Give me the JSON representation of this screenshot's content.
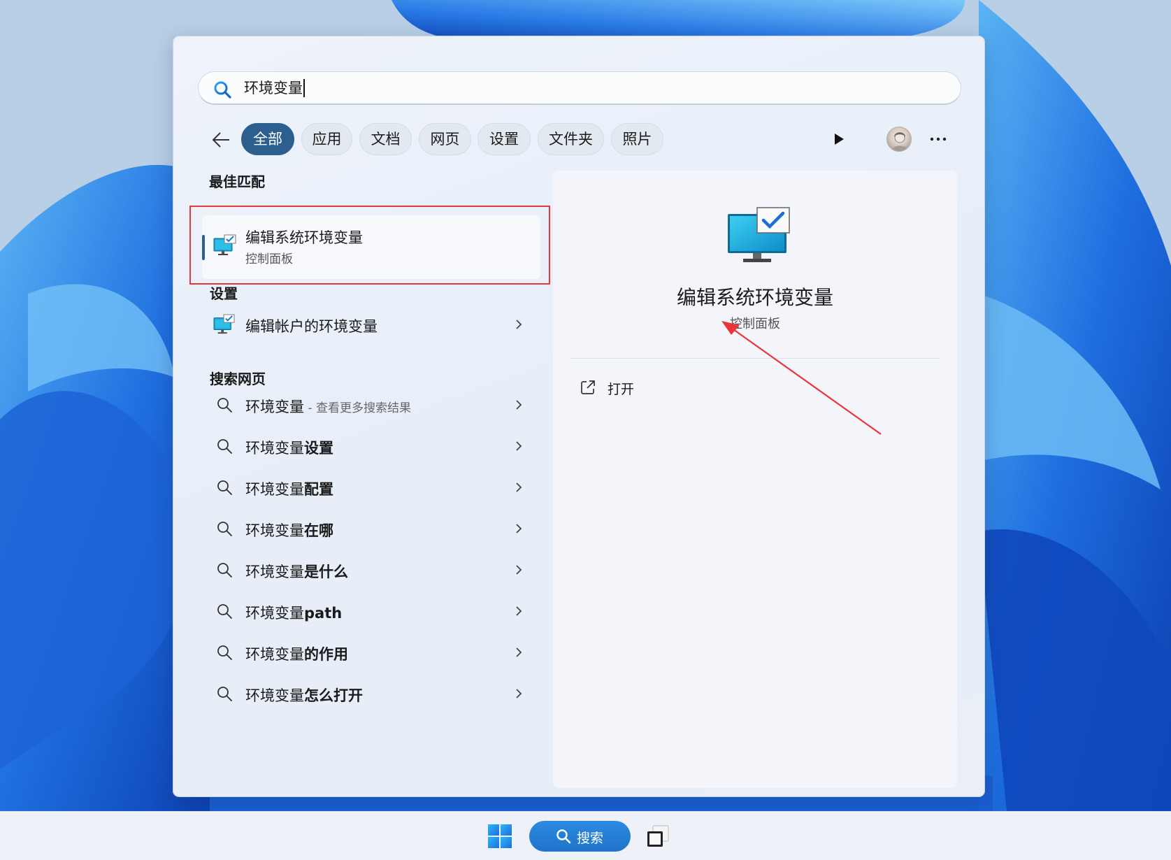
{
  "search": {
    "query": "环境变量"
  },
  "filters": [
    {
      "label": "全部",
      "active": true
    },
    {
      "label": "应用",
      "active": false
    },
    {
      "label": "文档",
      "active": false
    },
    {
      "label": "网页",
      "active": false
    },
    {
      "label": "设置",
      "active": false
    },
    {
      "label": "文件夹",
      "active": false
    },
    {
      "label": "照片",
      "active": false
    }
  ],
  "sections": {
    "best_match": "最佳匹配",
    "settings": "设置",
    "web": "搜索网页"
  },
  "best_match": {
    "title": "编辑系统环境变量",
    "subtitle": "控制面板"
  },
  "settings_result": {
    "label": "编辑帐户的环境变量"
  },
  "web_results": [
    {
      "prefix": "环境变量",
      "bold": "",
      "hint": " - 查看更多搜索结果"
    },
    {
      "prefix": "环境变量",
      "bold": "设置",
      "hint": ""
    },
    {
      "prefix": "环境变量",
      "bold": "配置",
      "hint": ""
    },
    {
      "prefix": "环境变量",
      "bold": "在哪",
      "hint": ""
    },
    {
      "prefix": "环境变量",
      "bold": "是什么",
      "hint": ""
    },
    {
      "prefix": "环境变量",
      "bold": "path",
      "hint": ""
    },
    {
      "prefix": "环境变量",
      "bold": "的作用",
      "hint": ""
    },
    {
      "prefix": "环境变量",
      "bold": "怎么打开",
      "hint": ""
    }
  ],
  "preview": {
    "title": "编辑系统环境变量",
    "subtitle": "控制面板",
    "actions": [
      {
        "label": "打开",
        "icon": "open-external-icon"
      }
    ]
  },
  "taskbar": {
    "search_label": "搜索"
  },
  "colors": {
    "accent": "#2c5e8e",
    "highlight_box": "#e8363a",
    "taskbar_search": "#1f73c9"
  }
}
